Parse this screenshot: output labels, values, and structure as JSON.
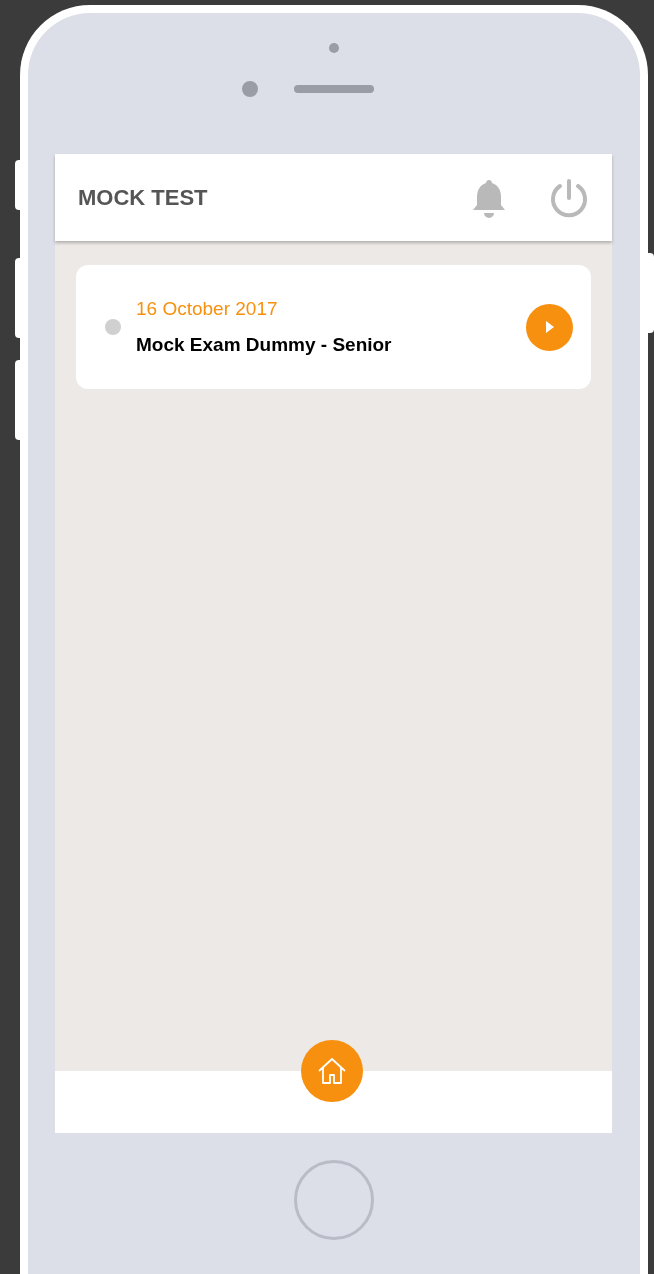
{
  "header": {
    "title": "MOCK TEST"
  },
  "exams": [
    {
      "date": "16 October 2017",
      "title": "Mock Exam Dummy - Senior"
    }
  ]
}
